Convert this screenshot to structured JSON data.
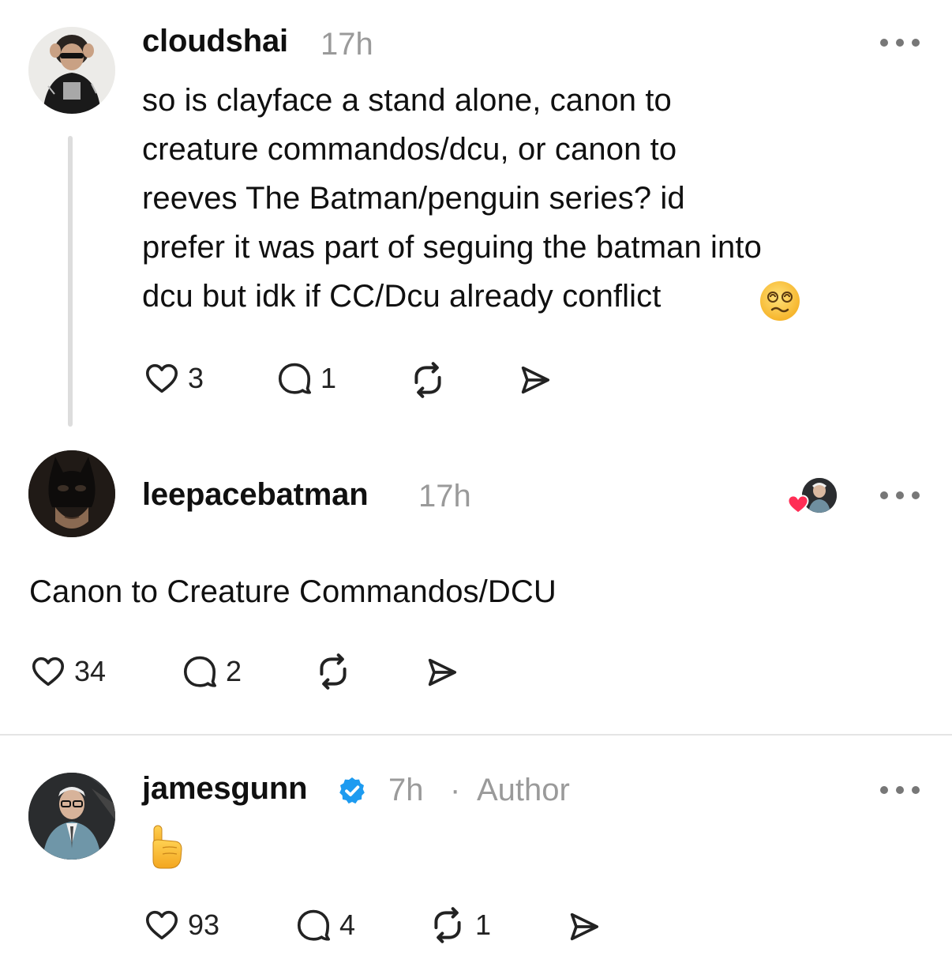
{
  "posts": [
    {
      "username": "cloudshai",
      "time": "17h",
      "text": "so is clayface a stand alone, canon to\ncreature commandos/dcu, or canon to\nreeves The Batman/penguin series? id\nprefer it was part of seguing the batman into\ndcu but idk if CC/Dcu already conflict",
      "emoji": "face-with-spiral-eyes",
      "likes": "3",
      "replies": "1",
      "reposts": "",
      "avatar_icon": "cloudshai-avatar"
    },
    {
      "username": "leepacebatman",
      "time": "17h",
      "text": "Canon to Creature Commandos/DCU",
      "likes": "34",
      "replies": "2",
      "reposts": "",
      "liked_by_author_icon": "author-like-heart-icon",
      "avatar_icon": "batman-avatar"
    },
    {
      "username": "jamesgunn",
      "time": "7h",
      "author_label": "Author",
      "separator": "·",
      "verified_icon": "verified-badge-icon",
      "text": "",
      "emoji": "backhand-index-pointing-up",
      "likes": "93",
      "replies": "4",
      "reposts": "1",
      "avatar_icon": "jamesgunn-avatar"
    }
  ],
  "colors": {
    "text": "#101010",
    "muted": "#9a9a9a",
    "verified": "#1d9bf0",
    "heart": "#ff2d55",
    "thread_line": "#dddddd"
  }
}
